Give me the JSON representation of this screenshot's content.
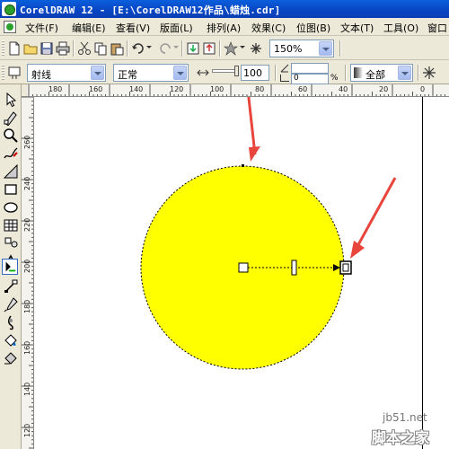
{
  "window": {
    "title": "CorelDRAW 12 - [E:\\CorelDRAW12作品\\蜡烛.cdr]"
  },
  "menu": {
    "items": [
      "文件(F)",
      "编辑(E)",
      "查看(V)",
      "版面(L)",
      "排列(A)",
      "效果(C)",
      "位图(B)",
      "文本(T)",
      "工具(O)",
      "窗口"
    ]
  },
  "standard_toolbar": {
    "zoom_level": "150%",
    "icons": [
      "new-icon",
      "open-icon",
      "save-icon",
      "print-icon",
      "cut-icon",
      "copy-icon",
      "paste-icon",
      "undo-icon",
      "redo-icon",
      "import-icon",
      "export-icon",
      "app-launcher-icon",
      "corel-online-icon"
    ]
  },
  "property_bar": {
    "fill_type": "射线",
    "mode": "正常",
    "midpoint_value": "100",
    "angle_value": "0",
    "percent_symbol": "%",
    "scope": "全部"
  },
  "rulers": {
    "top_labels": [
      "180",
      "160",
      "140",
      "120",
      "100",
      "80",
      "60",
      "40",
      "20",
      "0"
    ],
    "left_labels": [
      "260",
      "240",
      "220",
      "200",
      "180",
      "160",
      "140",
      "120"
    ]
  },
  "canvas": {
    "circle_fill_color": "#ffff00",
    "annotation_arrow_color": "#e8453c"
  },
  "watermark": {
    "site": "jb51.net",
    "name": "脚本之家"
  },
  "tools": [
    "pick-tool-icon",
    "shape-tool-icon",
    "zoom-tool-icon",
    "freehand-tool-icon",
    "smart-fill-icon",
    "rectangle-tool-icon",
    "ellipse-tool-icon",
    "polygon-tool-icon",
    "basic-shapes-icon",
    "text-tool-icon",
    "interactive-tool-icon",
    "interactive-fill-icon",
    "eyedropper-icon",
    "outline-tool-icon",
    "fill-tool-icon",
    "interactive-mesh-icon"
  ]
}
